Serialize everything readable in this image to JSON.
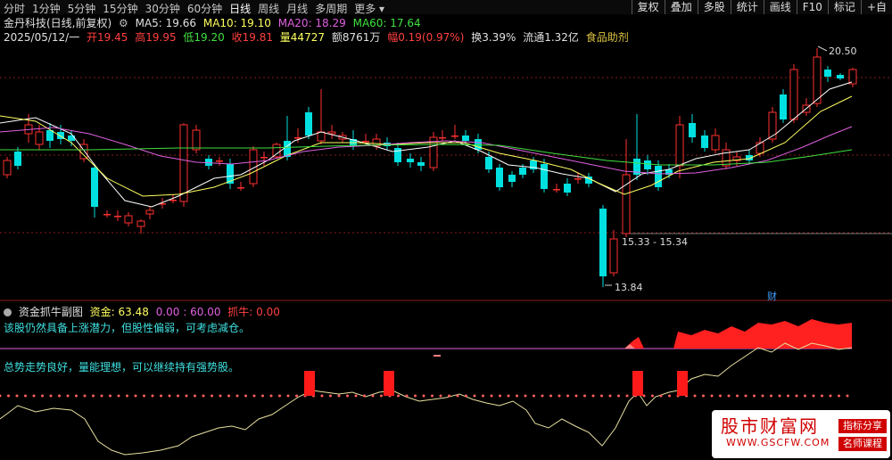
{
  "toolbar": {
    "periods": [
      "分时",
      "1分钟",
      "5分钟",
      "15分钟",
      "30分钟",
      "60分钟",
      "日线",
      "周线",
      "月线",
      "多周期",
      "更多"
    ],
    "active_period": "日线",
    "right_buttons": [
      "复权",
      "叠加",
      "多股",
      "统计",
      "画线",
      "F10",
      "标记",
      "+自"
    ]
  },
  "title_row": {
    "stock": "金丹科技(日线,前复权)",
    "ma5": "MA5: 19.66",
    "ma10": "MA10: 19.10",
    "ma20": "MA20: 18.29",
    "ma60": "MA60: 17.64"
  },
  "quote_row": {
    "date": "2025/05/12/一",
    "open": "开19.45",
    "high": "高19.95",
    "low": "低19.20",
    "close": "收19.81",
    "volume": "量44727",
    "amount": "额8761万",
    "change": "幅0.19(0.97%)",
    "turnover": "换3.39%",
    "float": "流通1.32亿",
    "sector": "食品助剂"
  },
  "annotations": {
    "high_price": "20.50",
    "low_price": "13.84",
    "range_label": "15.33 - 15.34",
    "fin_marker": "财"
  },
  "sub_panel": {
    "title": "资金抓牛副图",
    "fund": "资金: 63.48",
    "range": "0.00 : 60.00",
    "bull": "抓牛: 0.00",
    "hint1": "该股仍然具备上涨潜力，但股性偏弱，可考虑减仓。",
    "hint2": "总势走势良好，量能理想，可以继续持有强势股。"
  },
  "watermark": {
    "title": "股市财富网",
    "url": "WWW.GSCFW.COM",
    "tag1": "指标分享",
    "tag2": "名师课程"
  },
  "colors": {
    "up": "#ff3030",
    "down": "#00e0e0",
    "ma5": "#ffffff",
    "ma10": "#ffff60",
    "ma20": "#e060e0",
    "ma60": "#40e040"
  }
}
